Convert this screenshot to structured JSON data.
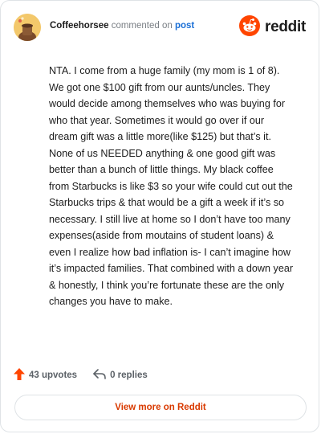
{
  "header": {
    "username": "Coffeehorsee",
    "action_text": "commented on",
    "post_type": "post",
    "brand": "reddit"
  },
  "comment": {
    "text": "NTA. I come from a huge family (my mom is 1 of 8). We got one $100 gift from our aunts/uncles. They would decide among themselves who was buying for who that year. Sometimes it would go over if our dream gift was a little more(like $125) but that’s it. None of us NEEDED anything & one good gift was better than a bunch of little things. My black coffee from Starbucks is like $3 so your wife could cut out the Starbucks trips & that would be a gift a week if it’s so necessary. I still live at home so I don’t have too many expenses(aside from moutains of student loans) & even I realize how bad inflation is- I can’t imagine how it’s impacted families. That combined with a down year & honestly, I think you’re fortunate these are the only changes you have to make."
  },
  "actions": {
    "upvotes_label": "43 upvotes",
    "replies_label": "0 replies"
  },
  "footer": {
    "view_more_label": "View more on Reddit"
  },
  "colors": {
    "brand_orange": "#ff4500",
    "link_orange": "#d93a00",
    "post_blue": "#1a6fd6"
  },
  "icons": {
    "avatar": "user-avatar",
    "logo": "reddit-snoo-icon",
    "upvote": "upvote-arrow-icon",
    "reply": "reply-arrow-icon"
  }
}
